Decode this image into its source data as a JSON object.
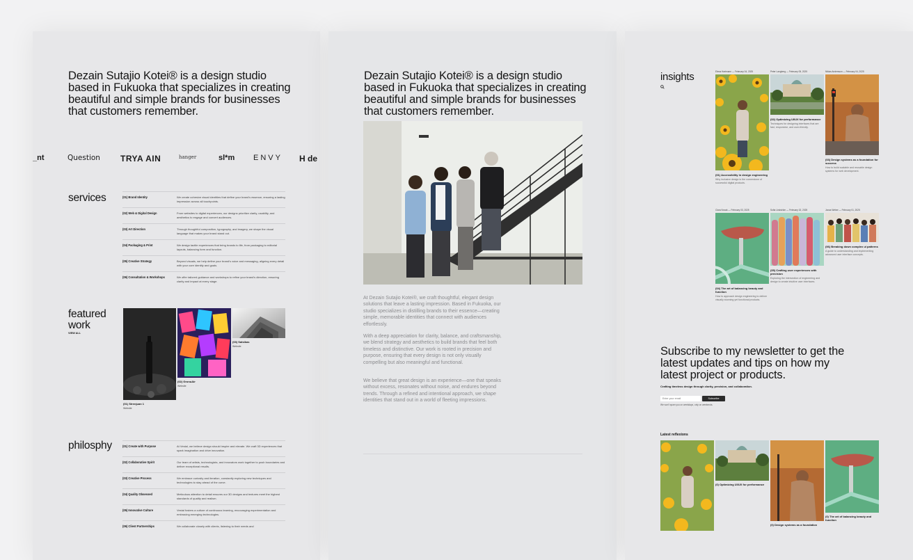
{
  "hero": "Dezain Sutajio Kotei® is a design studio based in Fukuoka that specializes in creating beautiful and simple brands for businesses that customers remember.",
  "logos": [
    "_nt",
    "Question",
    "TRYA AIN",
    "hanger",
    "sl*m",
    "ENVY",
    "H de"
  ],
  "services": {
    "title": "services",
    "items": [
      {
        "name": "(01) Brand Identity",
        "desc": "We create cohesive visual identities that define your brand's essence, ensuring a lasting impression across all touchpoints."
      },
      {
        "name": "(02) Web & Digital Design",
        "desc": "From websites to digital experiences, our designs prioritize clarity, usability, and aesthetics to engage and convert audiences."
      },
      {
        "name": "(03) Art Direction",
        "desc": "Through thoughtful composition, typography, and imagery, we shape the visual language that makes your brand stand out."
      },
      {
        "name": "(04) Packaging & Print",
        "desc": "We design tactile experiences that bring brands to life, from packaging to editorial layouts, balancing form and function."
      },
      {
        "name": "(05) Creative Strategy",
        "desc": "Beyond visuals, we help define your brand's voice and messaging, aligning every detail with your core identity and goals."
      },
      {
        "name": "(06) Consultation & Workshops",
        "desc": "We offer tailored guidance and workshops to refine your brand's direction, ensuring clarity and impact at every stage."
      }
    ]
  },
  "featured": {
    "title": "featured work",
    "view_all": "VIEW ALL",
    "items": [
      {
        "title": "(01) Strenjuan 1",
        "sub": "Website"
      },
      {
        "title": "(02) GronuAir",
        "sub": "Website"
      },
      {
        "title": "(03) Satsikas",
        "sub": "Website"
      }
    ]
  },
  "philosophy": {
    "title": "philosphy",
    "items": [
      {
        "name": "(01) Create with Purpose",
        "desc": "At Vestal, we believe design should inspire and elevate. We craft 3D experiences that spark imagination and drive innovation."
      },
      {
        "name": "(02) Collaborative Spirit",
        "desc": "Our team of artists, technologists, and innovators work together to push boundaries and deliver exceptional results."
      },
      {
        "name": "(03) Creative Process",
        "desc": "We embrace curiosity and iteration, constantly exploring new techniques and technologies to stay ahead of the curve."
      },
      {
        "name": "(04) Quality Obsessed",
        "desc": "Meticulous attention to detail ensures our 3D designs and textures meet the highest standards of quality and realism."
      },
      {
        "name": "(05) Innovative Culture",
        "desc": "Vestal fosters a culture of continuous learning, encouraging experimentation and embracing emerging technologies."
      },
      {
        "name": "(06) Client Partnerships",
        "desc": "We collaborate closely with clients, listening to their needs and"
      }
    ]
  },
  "about": {
    "paragraphs": [
      "At Dezain Sutajio Kotei®, we craft thoughtful, elegant design solutions that leave a lasting impression. Based in Fukuoka, our studio specializes in distilling brands to their essence—creating simple, memorable identities that connect with audiences effortlessly.",
      "With a deep appreciation for clarity, balance, and craftsmanship, we blend strategy and aesthetics to build brands that feel both timeless and distinctive. Our work is rooted in precision and purpose, ensuring that every design is not only visually compelling but also meaningful and functional.",
      "We believe that great design is an experience—one that speaks without excess, resonates without noise, and endures beyond trends. Through a refined and intentional approach, we shape identities that stand out in a world of fleeting impressions."
    ]
  },
  "insights": {
    "title": "insights",
    "posts": [
      {
        "meta": "Elena Hartmann — February 04, 2025",
        "title": "(01) Accessibility in design engineering",
        "excerpt": "Why inclusive design is the cornerstone of successful digital products."
      },
      {
        "meta": "Peter Langberg — February 05, 2025",
        "title": "(02) Optimizing UI/UX for performance",
        "excerpt": "Techniques for designing interfaces that are fast, responsive, and user-friendly."
      },
      {
        "meta": "Niklas Andersson — February 04, 2025",
        "title": "(03) Design systems as a foundation for success",
        "excerpt": "How to build scalable and reusable design systems for web development."
      },
      {
        "meta": "Clara Novak — February 03, 2025",
        "title": "(04) The art of balancing beauty and function",
        "excerpt": "How to approach design engineering to deliver visually stunning yet functional products."
      },
      {
        "meta": "Sofia Lindström — February 02, 2025",
        "title": "(05) Crafting user experiences with precision",
        "excerpt": "Exploring the intersection of engineering and design to create intuitive user interfaces."
      },
      {
        "meta": "Jonas Weber — February 01, 2025",
        "title": "(06) Breaking down complex ui patterns",
        "excerpt": "A guide to understanding and implementing advanced user interface concepts."
      }
    ]
  },
  "newsletter": {
    "title": "Subscribe to my newsletter to get the latest updates and tips on how my latest project or products.",
    "sub": "Crafting timeless design through clarity, precision, and collaboration.",
    "placeholder": "Enter your email",
    "button": "Subscribe",
    "note": "We won't spam you on weekdays, only on weekends."
  },
  "latest": {
    "title": "Latest reflexions",
    "items": [
      {
        "title": ""
      },
      {
        "title": "(0) Optimizing UI/UX for performance"
      },
      {
        "title": "(0) Design systems as a foundation"
      },
      {
        "title": "(0) The art of balancing beauty and function"
      }
    ]
  },
  "colors": {
    "bg": "#f2f2f3",
    "panel": "#e7e7e9",
    "text": "#141414",
    "button": "#2b2b2b"
  }
}
